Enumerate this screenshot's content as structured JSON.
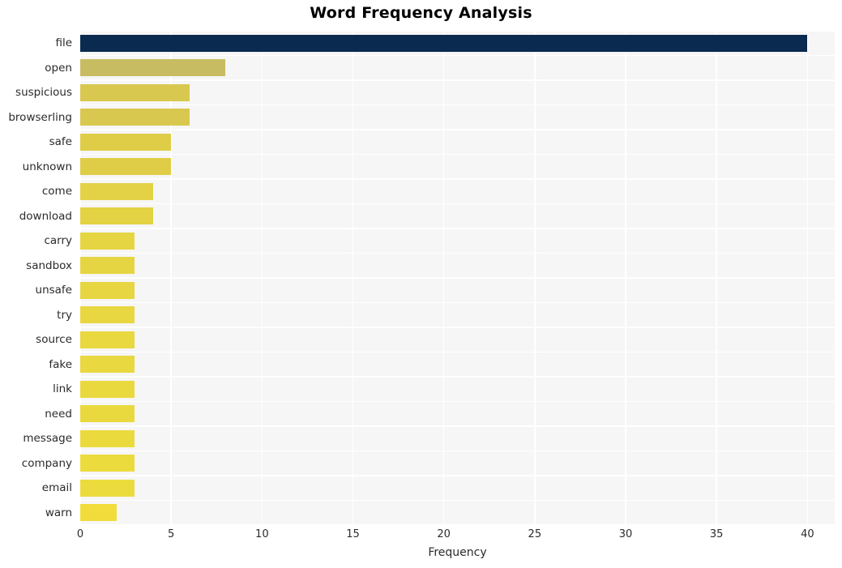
{
  "chart_data": {
    "type": "bar",
    "orientation": "horizontal",
    "title": "Word Frequency Analysis",
    "xlabel": "Frequency",
    "ylabel": "",
    "categories": [
      "file",
      "open",
      "suspicious",
      "browserling",
      "safe",
      "unknown",
      "come",
      "download",
      "carry",
      "sandbox",
      "unsafe",
      "try",
      "source",
      "fake",
      "link",
      "need",
      "message",
      "company",
      "email",
      "warn"
    ],
    "values": [
      40,
      8,
      6,
      6,
      5,
      5,
      4,
      4,
      3,
      3,
      3,
      3,
      3,
      3,
      3,
      3,
      3,
      3,
      3,
      2
    ],
    "xlim": [
      0,
      41.5
    ],
    "xticks": [
      0,
      5,
      10,
      15,
      20,
      25,
      30,
      35,
      40
    ],
    "xticklabels": [
      "0",
      "5",
      "10",
      "15",
      "20",
      "25",
      "30",
      "35",
      "40"
    ],
    "grid": true,
    "legend": null,
    "bar_colors": [
      "#0b2a4f",
      "#c8bc63",
      "#d9c84f",
      "#d9c84f",
      "#dfcd48",
      "#dfcd48",
      "#e3d246",
      "#e3d244",
      "#e6d542",
      "#e6d542",
      "#e7d641",
      "#e8d740",
      "#e9d83f",
      "#e9d83f",
      "#ead93e",
      "#ead93e",
      "#ebda3e",
      "#ecdb3d",
      "#ecdb3d",
      "#f2dc3c"
    ],
    "plot_background": "#f6f6f6",
    "figure_background": "#ffffff",
    "gridline_color": "#ffffff",
    "text_color": "#2b2b2b"
  }
}
